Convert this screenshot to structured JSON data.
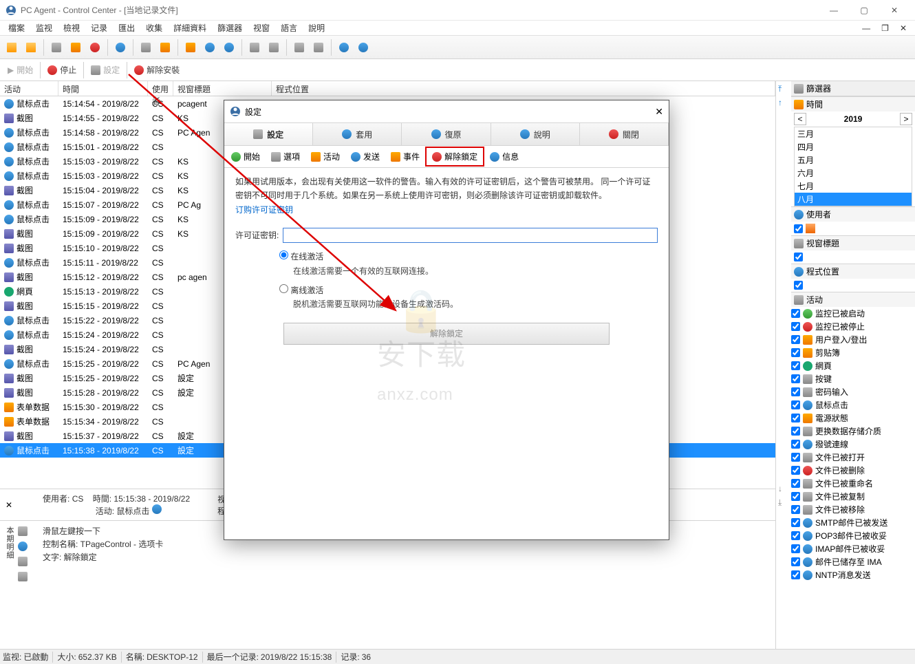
{
  "window": {
    "title": "PC Agent - Control Center - [当地记录文件]"
  },
  "menu": [
    "檔案",
    "监视",
    "檢視",
    "记录",
    "匯出",
    "收集",
    "詳細資料",
    "篩選器",
    "视窗",
    "語言",
    "說明"
  ],
  "toolbar2": {
    "start": "開始",
    "stop": "停止",
    "settings": "設定",
    "uninstall": "解除安裝"
  },
  "grid": {
    "cols": [
      "活动",
      "時間",
      "使用者",
      "视窗標題",
      "程式位置"
    ],
    "rows": [
      [
        "鼠标点击",
        "15:14:54 - 2019/8/22",
        "CS",
        "pcagent",
        "",
        "mouse"
      ],
      [
        "截图",
        "15:14:55 - 2019/8/22",
        "CS",
        "KS",
        "",
        "cam"
      ],
      [
        "鼠标点击",
        "15:14:58 - 2019/8/22",
        "CS",
        "PC Agen",
        "",
        "mouse"
      ],
      [
        "鼠标点击",
        "15:15:01 - 2019/8/22",
        "CS",
        "",
        "",
        "mouse"
      ],
      [
        "鼠标点击",
        "15:15:03 - 2019/8/22",
        "CS",
        "KS",
        "",
        "mouse"
      ],
      [
        "鼠标点击",
        "15:15:03 - 2019/8/22",
        "CS",
        "KS",
        "",
        "mouse"
      ],
      [
        "截图",
        "15:15:04 - 2019/8/22",
        "CS",
        "KS",
        "",
        "cam"
      ],
      [
        "鼠标点击",
        "15:15:07 - 2019/8/22",
        "CS",
        "PC Ag",
        "",
        "mouse"
      ],
      [
        "鼠标点击",
        "15:15:09 - 2019/8/22",
        "CS",
        "KS",
        "",
        "mouse"
      ],
      [
        "截图",
        "15:15:09 - 2019/8/22",
        "CS",
        "KS",
        "",
        "cam"
      ],
      [
        "截图",
        "15:15:10 - 2019/8/22",
        "CS",
        "",
        "",
        "cam"
      ],
      [
        "鼠标点击",
        "15:15:11 - 2019/8/22",
        "CS",
        "",
        "",
        "mouse"
      ],
      [
        "截图",
        "15:15:12 - 2019/8/22",
        "CS",
        "pc agen",
        "",
        "cam"
      ],
      [
        "網頁",
        "15:15:13 - 2019/8/22",
        "CS",
        "",
        "",
        "web"
      ],
      [
        "截图",
        "15:15:15 - 2019/8/22",
        "CS",
        "",
        "",
        "cam"
      ],
      [
        "鼠标点击",
        "15:15:22 - 2019/8/22",
        "CS",
        "",
        "",
        "mouse"
      ],
      [
        "鼠标点击",
        "15:15:24 - 2019/8/22",
        "CS",
        "",
        "",
        "mouse"
      ],
      [
        "截图",
        "15:15:24 - 2019/8/22",
        "CS",
        "",
        "",
        "cam"
      ],
      [
        "鼠标点击",
        "15:15:25 - 2019/8/22",
        "CS",
        "PC Agen",
        "",
        "mouse"
      ],
      [
        "截图",
        "15:15:25 - 2019/8/22",
        "CS",
        "設定",
        "",
        "cam"
      ],
      [
        "截图",
        "15:15:28 - 2019/8/22",
        "CS",
        "設定",
        "",
        "cam"
      ],
      [
        "表单数据",
        "15:15:30 - 2019/8/22",
        "CS",
        "",
        "",
        "form"
      ],
      [
        "表单数据",
        "15:15:34 - 2019/8/22",
        "CS",
        "",
        "",
        "form"
      ],
      [
        "截图",
        "15:15:37 - 2019/8/22",
        "CS",
        "設定",
        "",
        "cam"
      ],
      [
        "鼠标点击",
        "15:15:38 - 2019/8/22",
        "CS",
        "設定",
        "",
        "mouse"
      ]
    ],
    "lastSelected": 24
  },
  "detail": {
    "user_label": "使用者:",
    "user": "CS",
    "time_label": "時間:",
    "time": "15:15:38 - 2019/8/22",
    "wintitle_label": "视窗標題",
    "activity_label": "活动:",
    "activity": "鼠标点击",
    "progloc_label": "程式位置",
    "line1": "滑鼠左鍵按一下",
    "line2": "控制名稱: TPageControl - 选项卡",
    "line3": "文字: 解除鎖定"
  },
  "right": {
    "filter": "篩選器",
    "time": "時間",
    "year": "2019",
    "months": [
      "三月",
      "四月",
      "五月",
      "六月",
      "七月",
      "八月"
    ],
    "month_sel": 5,
    "user": "使用者",
    "wt": "视窗標題",
    "pl": "程式位置",
    "act": "活动",
    "activities": [
      "监控已被启动",
      "监控已被停止",
      "用户登入/登出",
      "剪贴簿",
      "網頁",
      "按键",
      "密码输入",
      "鼠标点击",
      "電源狀態",
      "更换数据存储介质",
      "撥號連線",
      "文件已被打开",
      "文件已被删除",
      "文件已被重命名",
      "文件已被复制",
      "文件已被移除",
      "SMTP邮件已被发送",
      "POP3邮件已被收妥",
      "IMAP邮件已被收妥",
      "邮件已储存至 IMA",
      "NNTP消息发送"
    ]
  },
  "status": {
    "mon_label": "监视:",
    "mon": "已啟動",
    "size_label": "大小:",
    "size": "652.37 KB",
    "name_label": "名稱:",
    "name": "DESKTOP-12",
    "last_label": "最后一个记录:",
    "last": "2019/8/22 15:15:38",
    "rec_label": "记录:",
    "rec": "36"
  },
  "dialog": {
    "title": "設定",
    "bar": [
      "設定",
      "套用",
      "復原",
      "說明",
      "關閉"
    ],
    "tabs": [
      "開始",
      "選項",
      "活动",
      "发送",
      "事件",
      "解除鎖定",
      "信息"
    ],
    "tab_sel": 5,
    "text1": "如果用试用版本，会出现有关使用这一软件的警告。输入有效的许可证密钥后，这个警告可被禁用。 同一个许可证密钥不可同时用于几个系统。如果在另一系统上使用许可密钥，则必须删除该许可证密钥或卸载软件。",
    "link": "订购许可证密钥",
    "key_label": "许可证密钥:",
    "r1": "在线激活",
    "r1d": "在线激活需要一个有效的互联网连接。",
    "r2": "离线激活",
    "r2d": "脱机激活需要互联网功能的设备生成激活码。",
    "btn": "解除鎖定"
  },
  "watermark": "安下载\nanxz.com"
}
